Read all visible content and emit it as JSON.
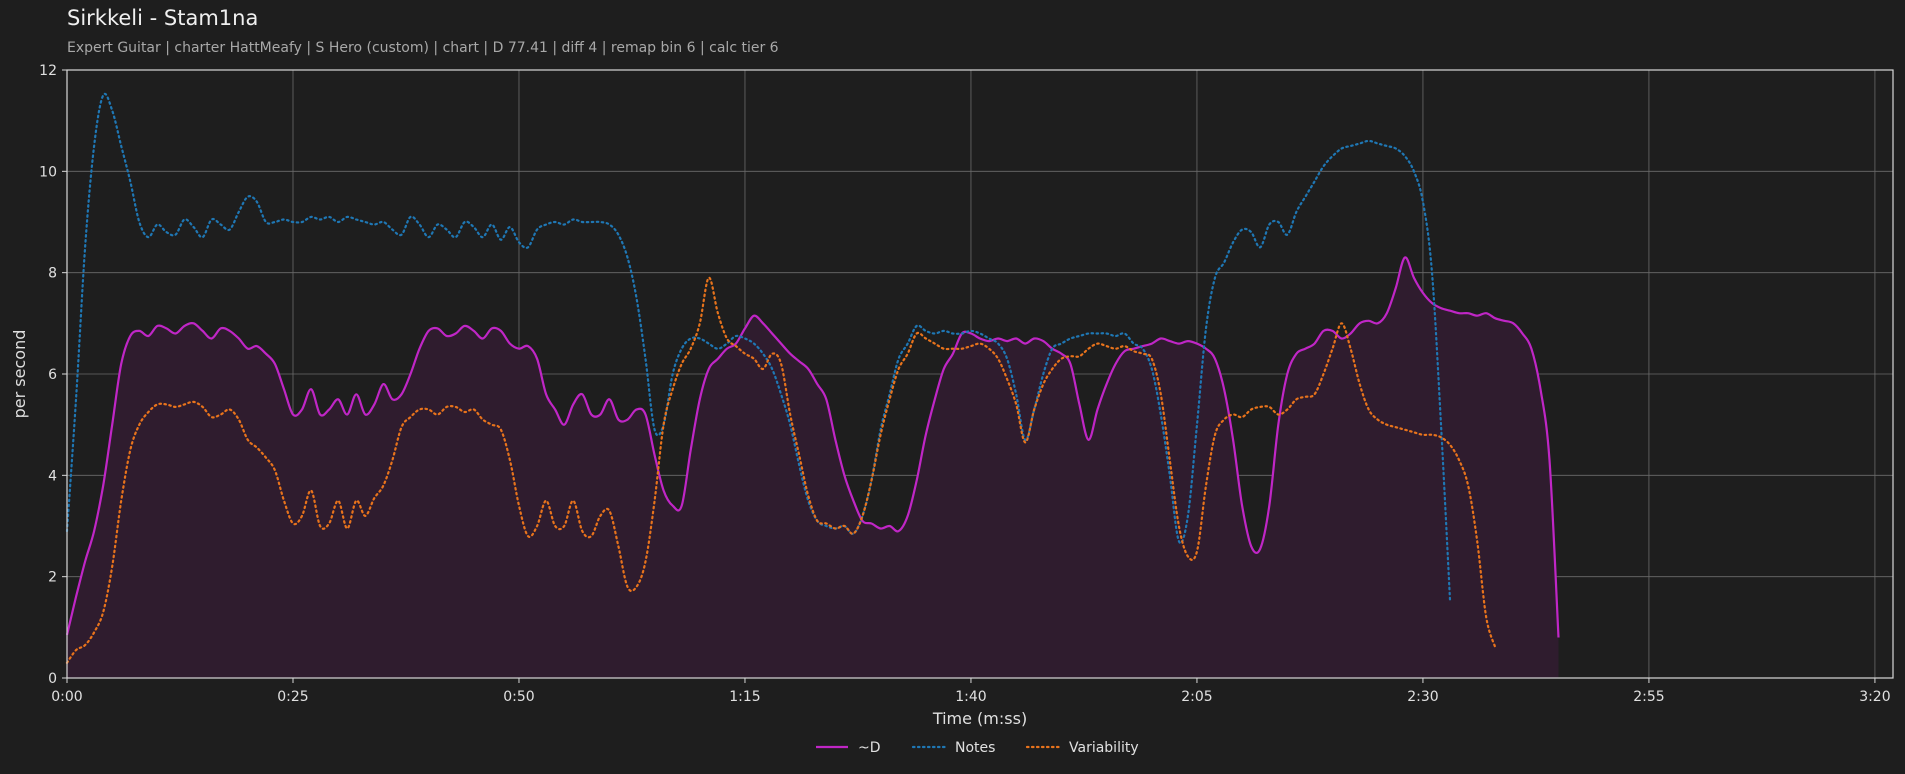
{
  "chart_data": {
    "type": "line",
    "title": "Sirkkeli - Stam1na",
    "subtitle": "Expert Guitar  |  charter HattMeafy  |  S Hero (custom)  |  chart  |  D 77.41  |  diff 4  |  remap bin 6  |  calc tier 6",
    "xlabel": "Time (m:ss)",
    "ylabel": "per second",
    "xlim": [
      0,
      202
    ],
    "ylim": [
      0,
      12
    ],
    "x_ticks": [
      0,
      25,
      50,
      75,
      100,
      125,
      150,
      175,
      200
    ],
    "x_tick_labels": [
      "0:00",
      "0:25",
      "0:50",
      "1:15",
      "1:40",
      "2:05",
      "2:30",
      "2:55",
      "3:20"
    ],
    "y_ticks": [
      0,
      2,
      4,
      6,
      8,
      10,
      12
    ],
    "y_tick_labels": [
      "0",
      "2",
      "4",
      "6",
      "8",
      "10",
      "12"
    ],
    "grid": true,
    "legend_position": "bottom-center",
    "x": [
      0,
      1,
      2,
      3,
      4,
      5,
      6,
      7,
      8,
      9,
      10,
      11,
      12,
      13,
      14,
      15,
      16,
      17,
      18,
      19,
      20,
      21,
      22,
      23,
      24,
      25,
      26,
      27,
      28,
      29,
      30,
      31,
      32,
      33,
      34,
      35,
      36,
      37,
      38,
      39,
      40,
      41,
      42,
      43,
      44,
      45,
      46,
      47,
      48,
      49,
      50,
      51,
      52,
      53,
      54,
      55,
      56,
      57,
      58,
      59,
      60,
      61,
      62,
      63,
      64,
      65,
      66,
      67,
      68,
      69,
      70,
      71,
      72,
      73,
      74,
      75,
      76,
      77,
      78,
      79,
      80,
      81,
      82,
      83,
      84,
      85,
      86,
      87,
      88,
      89,
      90,
      91,
      92,
      93,
      94,
      95,
      96,
      97,
      98,
      99,
      100,
      101,
      102,
      103,
      104,
      105,
      106,
      107,
      108,
      109,
      110,
      111,
      112,
      113,
      114,
      115,
      116,
      117,
      118,
      119,
      120,
      121,
      122,
      123,
      124,
      125,
      126,
      127,
      128,
      129,
      130,
      131,
      132,
      133,
      134,
      135,
      136,
      137,
      138,
      139,
      140,
      141,
      142,
      143,
      144,
      145,
      146,
      147,
      148,
      149,
      150,
      151,
      152,
      153,
      154,
      155,
      156,
      157,
      158,
      159,
      160,
      161,
      162,
      163,
      164,
      165,
      166,
      167,
      168,
      169,
      170,
      171,
      172,
      173,
      174,
      175,
      176,
      177,
      178,
      179,
      180,
      181,
      182,
      183,
      184,
      185,
      186,
      187,
      188,
      189,
      190,
      191,
      192,
      193,
      194,
      195,
      196,
      197,
      198,
      199,
      200,
      201,
      202
    ],
    "series": [
      {
        "name": "~D",
        "style": "solid",
        "color": "#c026c6",
        "fill": true,
        "values": [
          0.85,
          1.6,
          2.3,
          2.9,
          3.8,
          5.0,
          6.2,
          6.75,
          6.85,
          6.75,
          6.95,
          6.9,
          6.8,
          6.95,
          7.0,
          6.85,
          6.7,
          6.9,
          6.85,
          6.7,
          6.5,
          6.55,
          6.4,
          6.2,
          5.7,
          5.2,
          5.3,
          5.7,
          5.2,
          5.3,
          5.5,
          5.2,
          5.6,
          5.2,
          5.4,
          5.8,
          5.5,
          5.6,
          6.0,
          6.5,
          6.85,
          6.9,
          6.75,
          6.8,
          6.95,
          6.85,
          6.7,
          6.9,
          6.85,
          6.6,
          6.5,
          6.55,
          6.3,
          5.6,
          5.3,
          5.0,
          5.4,
          5.6,
          5.2,
          5.2,
          5.5,
          5.1,
          5.1,
          5.3,
          5.2,
          4.4,
          3.7,
          3.4,
          3.4,
          4.5,
          5.5,
          6.1,
          6.3,
          6.5,
          6.6,
          6.9,
          7.15,
          7.0,
          6.8,
          6.6,
          6.4,
          6.25,
          6.1,
          5.8,
          5.5,
          4.7,
          4.0,
          3.5,
          3.1,
          3.05,
          2.95,
          3.0,
          2.9,
          3.2,
          3.9,
          4.8,
          5.5,
          6.1,
          6.4,
          6.8,
          6.8,
          6.7,
          6.65,
          6.7,
          6.65,
          6.7,
          6.6,
          6.7,
          6.65,
          6.5,
          6.4,
          6.2,
          5.4,
          4.7,
          5.3,
          5.8,
          6.2,
          6.45,
          6.5,
          6.55,
          6.6,
          6.7,
          6.65,
          6.6,
          6.65,
          6.6,
          6.5,
          6.3,
          5.7,
          4.7,
          3.4,
          2.6,
          2.55,
          3.4,
          5.0,
          6.0,
          6.4,
          6.5,
          6.6,
          6.85,
          6.85,
          6.7,
          6.8,
          7.0,
          7.05,
          7.0,
          7.2,
          7.7,
          8.3,
          7.9,
          7.6,
          7.4,
          7.3,
          7.25,
          7.2,
          7.2,
          7.15,
          7.2,
          7.1,
          7.05,
          7.0,
          6.8,
          6.5,
          5.7,
          4.3,
          0.8
        ]
      },
      {
        "name": "Notes",
        "style": "dotted",
        "color": "#1f77b4",
        "fill": false,
        "values": [
          2.9,
          5.5,
          8.5,
          10.5,
          11.5,
          11.2,
          10.5,
          9.8,
          9.0,
          8.7,
          8.95,
          8.8,
          8.75,
          9.05,
          8.9,
          8.7,
          9.05,
          8.95,
          8.85,
          9.2,
          9.5,
          9.4,
          9.0,
          9.0,
          9.05,
          9.0,
          9.0,
          9.1,
          9.05,
          9.1,
          9.0,
          9.1,
          9.05,
          9.0,
          8.95,
          9.0,
          8.85,
          8.75,
          9.1,
          8.95,
          8.7,
          8.95,
          8.85,
          8.7,
          9.0,
          8.9,
          8.7,
          8.95,
          8.65,
          8.9,
          8.6,
          8.5,
          8.85,
          8.95,
          9.0,
          8.95,
          9.05,
          9.0,
          9.0,
          9.0,
          8.95,
          8.75,
          8.3,
          7.5,
          6.3,
          4.9,
          5.0,
          6.0,
          6.5,
          6.7,
          6.7,
          6.6,
          6.5,
          6.6,
          6.75,
          6.7,
          6.6,
          6.4,
          6.1,
          5.6,
          5.0,
          4.2,
          3.5,
          3.1,
          3.0,
          2.95,
          3.0,
          2.85,
          3.2,
          3.9,
          4.9,
          5.6,
          6.3,
          6.6,
          6.95,
          6.85,
          6.8,
          6.85,
          6.8,
          6.8,
          6.85,
          6.8,
          6.7,
          6.6,
          6.3,
          5.6,
          4.7,
          5.3,
          6.0,
          6.5,
          6.6,
          6.7,
          6.75,
          6.8,
          6.8,
          6.8,
          6.75,
          6.8,
          6.6,
          6.5,
          6.1,
          5.2,
          4.0,
          2.7,
          3.2,
          5.0,
          6.9,
          7.9,
          8.2,
          8.6,
          8.85,
          8.8,
          8.5,
          8.95,
          9.0,
          8.75,
          9.2,
          9.5,
          9.8,
          10.1,
          10.3,
          10.45,
          10.5,
          10.55,
          10.6,
          10.55,
          10.5,
          10.45,
          10.3,
          10.0,
          9.4,
          8.0,
          5.0,
          1.5
        ]
      },
      {
        "name": "Variability",
        "style": "dotted",
        "color": "#e8731c",
        "fill": false,
        "values": [
          0.3,
          0.55,
          0.65,
          0.9,
          1.3,
          2.2,
          3.5,
          4.5,
          5.0,
          5.25,
          5.4,
          5.4,
          5.35,
          5.4,
          5.45,
          5.35,
          5.15,
          5.2,
          5.3,
          5.1,
          4.7,
          4.55,
          4.35,
          4.1,
          3.5,
          3.05,
          3.2,
          3.7,
          3.0,
          3.05,
          3.5,
          2.95,
          3.5,
          3.2,
          3.55,
          3.8,
          4.3,
          4.95,
          5.15,
          5.3,
          5.3,
          5.2,
          5.35,
          5.35,
          5.25,
          5.3,
          5.1,
          5.0,
          4.9,
          4.3,
          3.4,
          2.8,
          3.0,
          3.5,
          3.0,
          3.0,
          3.5,
          2.9,
          2.8,
          3.2,
          3.3,
          2.6,
          1.8,
          1.8,
          2.3,
          3.5,
          5.0,
          5.7,
          6.2,
          6.5,
          7.0,
          7.9,
          7.2,
          6.7,
          6.55,
          6.4,
          6.3,
          6.1,
          6.4,
          6.2,
          5.2,
          4.4,
          3.6,
          3.1,
          3.05,
          2.95,
          3.0,
          2.85,
          3.2,
          3.9,
          4.8,
          5.5,
          6.1,
          6.4,
          6.8,
          6.7,
          6.6,
          6.5,
          6.5,
          6.5,
          6.55,
          6.6,
          6.5,
          6.3,
          5.9,
          5.4,
          4.65,
          5.3,
          5.8,
          6.1,
          6.3,
          6.35,
          6.35,
          6.5,
          6.6,
          6.55,
          6.5,
          6.55,
          6.45,
          6.4,
          6.3,
          5.6,
          4.3,
          3.0,
          2.4,
          2.5,
          3.8,
          4.8,
          5.1,
          5.2,
          5.15,
          5.3,
          5.35,
          5.35,
          5.2,
          5.3,
          5.5,
          5.55,
          5.6,
          6.0,
          6.5,
          7.0,
          6.5,
          5.8,
          5.3,
          5.1,
          5.0,
          4.95,
          4.9,
          4.85,
          4.8,
          4.8,
          4.75,
          4.6,
          4.3,
          3.8,
          2.7,
          1.2,
          0.6
        ]
      }
    ]
  },
  "colors": {
    "background": "#1e1e1e",
    "grid": "#6b6b6b",
    "frame": "#d8d8d8",
    "area_fill": "#2f1c2e"
  }
}
